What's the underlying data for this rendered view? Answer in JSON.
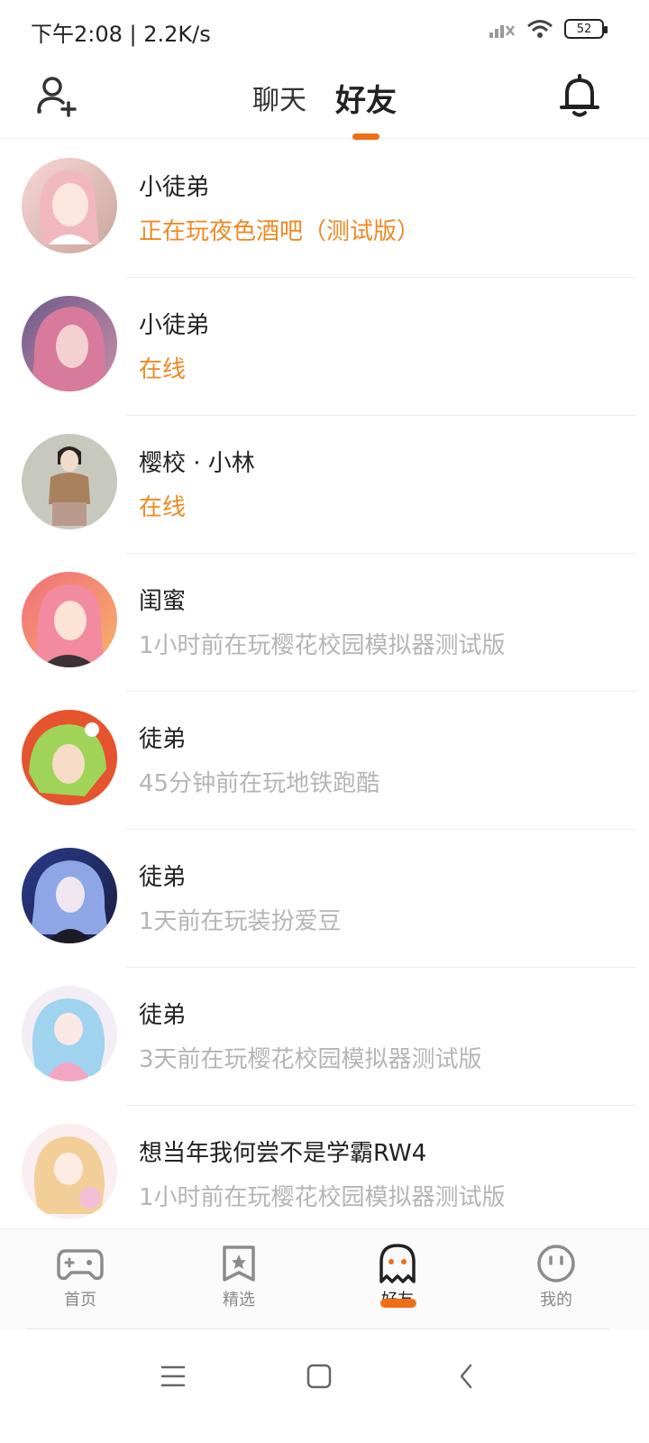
{
  "status_bar": {
    "time": "下午2:08 | 2.2K/s",
    "battery": "52"
  },
  "header": {
    "tabs": [
      {
        "label": "聊天"
      },
      {
        "label": "好友"
      }
    ],
    "active_tab": 1
  },
  "friends": [
    {
      "name": "小徒弟",
      "status": "正在玩夜色酒吧（测试版）",
      "online": true
    },
    {
      "name": "小徒弟",
      "status": "在线",
      "online": true
    },
    {
      "name": "樱校 · 小林",
      "status": "在线",
      "online": true
    },
    {
      "name": "闺蜜",
      "status": "1小时前在玩樱花校园模拟器测试版",
      "online": false
    },
    {
      "name": "徒弟",
      "status": "45分钟前在玩地铁跑酷",
      "online": false
    },
    {
      "name": "徒弟",
      "status": "1天前在玩装扮爱豆",
      "online": false
    },
    {
      "name": "徒弟",
      "status": "3天前在玩樱花校园模拟器测试版",
      "online": false
    },
    {
      "name": "想当年我何尝不是学霸RW4",
      "status": "1小时前在玩樱花校园模拟器测试版",
      "online": false
    }
  ],
  "bottom_nav": {
    "items": [
      {
        "label": "首页",
        "icon": "gamepad-icon"
      },
      {
        "label": "精选",
        "icon": "star-bookmark-icon"
      },
      {
        "label": "好友",
        "icon": "ghost-icon"
      },
      {
        "label": "我的",
        "icon": "face-icon"
      }
    ],
    "active": 2
  },
  "colors": {
    "accent": "#ef6f18",
    "online_text": "#ef8a23",
    "offline_text": "#b5b5b5"
  }
}
